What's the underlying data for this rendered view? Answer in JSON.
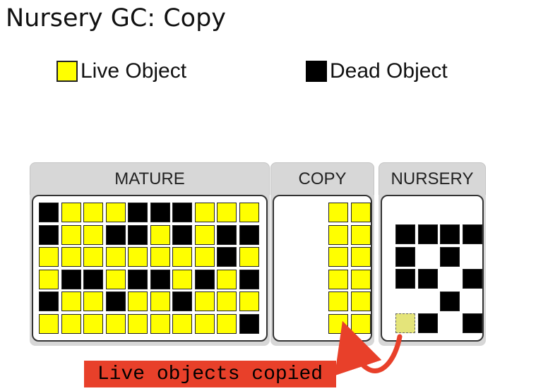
{
  "title": "Nursery GC: Copy",
  "legend": [
    {
      "label": "Live Object",
      "state": "live",
      "color": "#ffff00"
    },
    {
      "label": "Dead Object",
      "state": "dead",
      "color": "#000000"
    }
  ],
  "colors": {
    "live": "#ffff00",
    "dead": "#000000",
    "header": "#d7d7d7",
    "callout": "#e8402a"
  },
  "panels": {
    "mature": {
      "label": "MATURE",
      "cells": [
        [
          "dead",
          "live",
          "live",
          "live",
          "dead",
          "dead",
          "dead",
          "live",
          "live",
          "live"
        ],
        [
          "dead",
          "live",
          "live",
          "dead",
          "dead",
          "live",
          "dead",
          "live",
          "dead",
          "dead"
        ],
        [
          "live",
          "live",
          "live",
          "live",
          "live",
          "live",
          "live",
          "live",
          "dead",
          "live"
        ],
        [
          "live",
          "dead",
          "dead",
          "live",
          "dead",
          "dead",
          "live",
          "dead",
          "live",
          "dead"
        ],
        [
          "dead",
          "live",
          "live",
          "dead",
          "live",
          "live",
          "dead",
          "live",
          "live",
          "live"
        ],
        [
          "live",
          "live",
          "live",
          "live",
          "live",
          "live",
          "live",
          "live",
          "live",
          "dead"
        ]
      ]
    },
    "copy": {
      "label": "COPY",
      "cells": [
        [
          "live",
          "live"
        ],
        [
          "live",
          "live"
        ],
        [
          "live",
          "live"
        ],
        [
          "live",
          "live"
        ],
        [
          "live",
          "live"
        ],
        [
          "live",
          "live"
        ]
      ]
    },
    "nursery": {
      "label": "NURSERY",
      "cells": [
        [
          "dead",
          "dead",
          "dead",
          "dead"
        ],
        [
          "dead",
          "none",
          "dead",
          "none"
        ],
        [
          "dead",
          "dead",
          "none",
          "dead"
        ],
        [
          "none",
          "none",
          "dead",
          "none"
        ],
        [
          "empty",
          "dead",
          "none",
          "dead"
        ]
      ]
    }
  },
  "callout": "Live objects copied"
}
